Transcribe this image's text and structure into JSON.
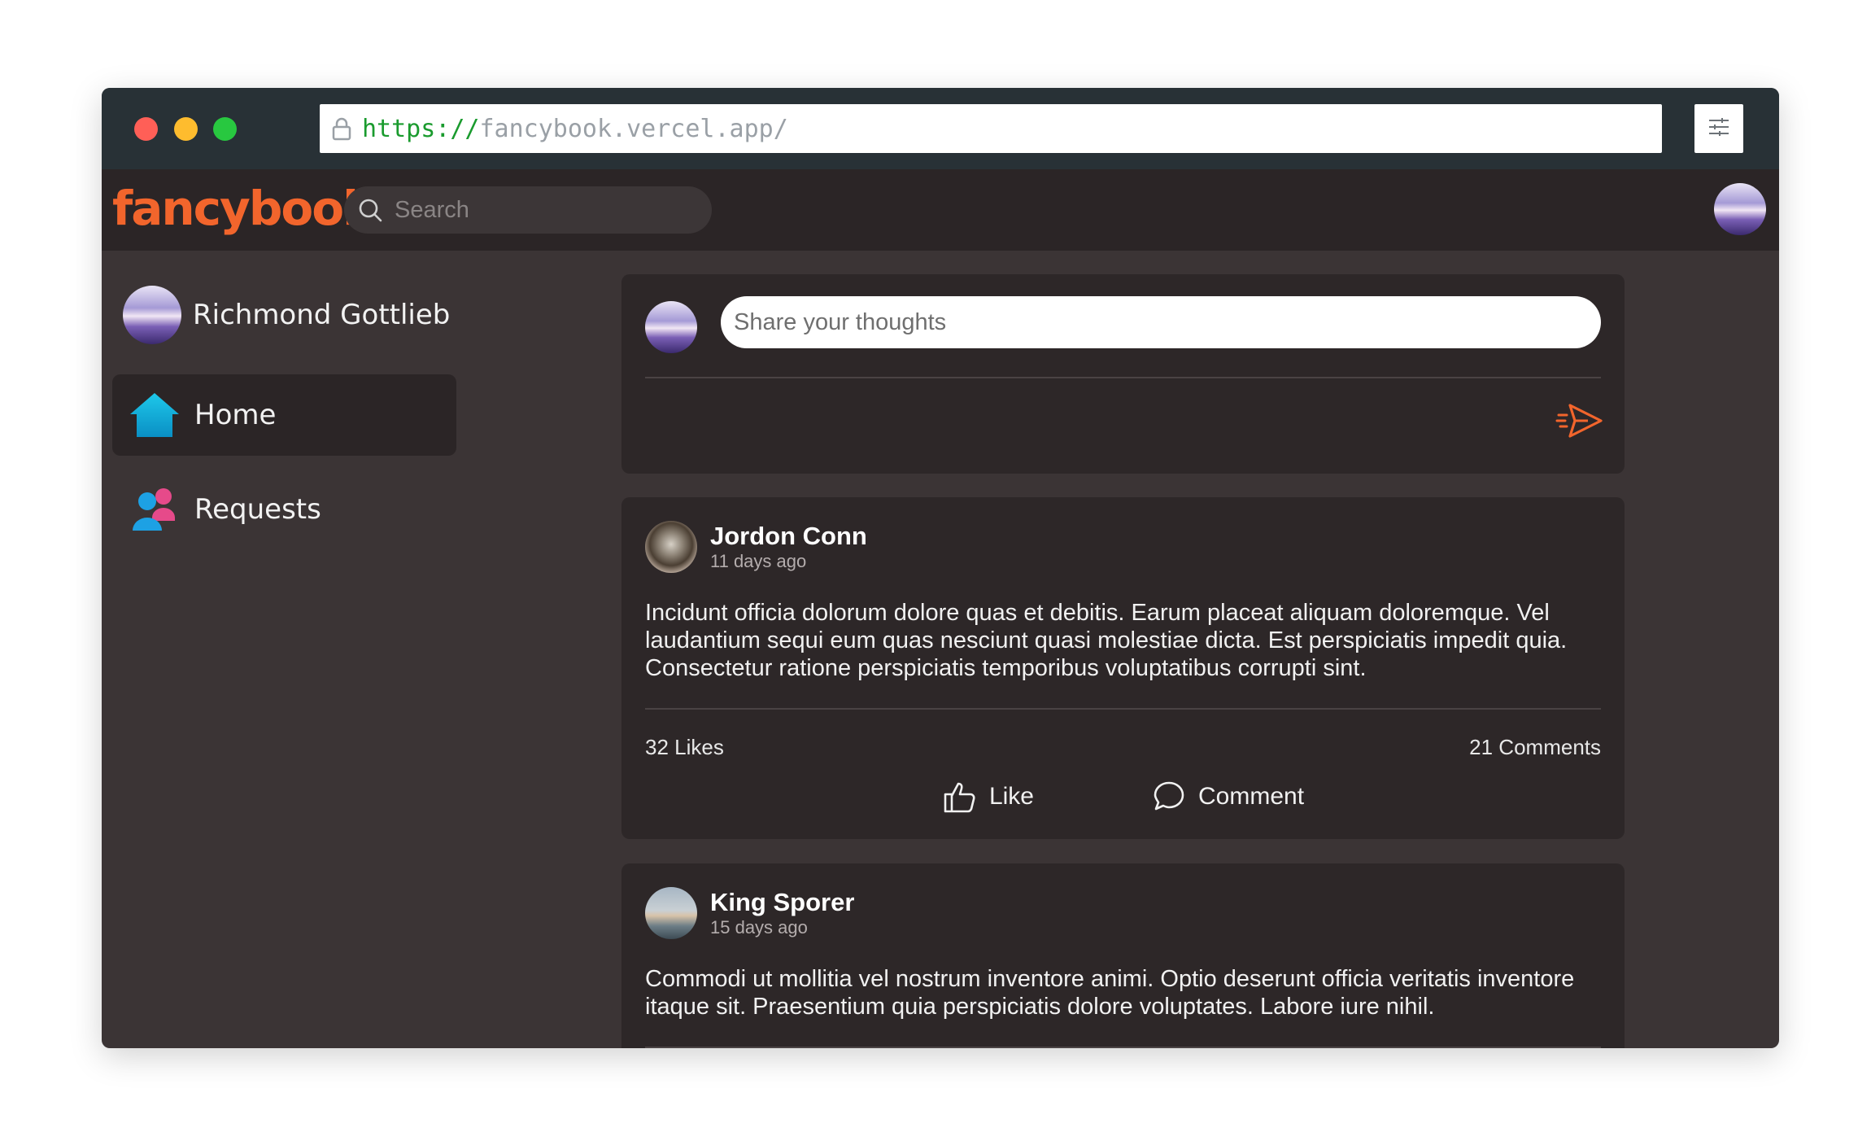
{
  "browser": {
    "url_scheme": "https://",
    "url_host": "fancybook.vercel.app/",
    "traffic_lights": [
      "#ff5f57",
      "#febc2e",
      "#28c840"
    ],
    "menu_icon": "sliders-icon"
  },
  "topnav": {
    "logo": "fancybook",
    "search_placeholder": "Search",
    "brand_color": "#f2652c"
  },
  "sidebar": {
    "user_name": "Richmond Gottlieb",
    "items": [
      {
        "label": "Home",
        "icon": "home-icon",
        "active": true
      },
      {
        "label": "Requests",
        "icon": "friends-icon",
        "active": false
      }
    ]
  },
  "composer": {
    "placeholder": "Share your thoughts",
    "send_icon": "send-icon"
  },
  "posts": [
    {
      "author": "Jordon Conn",
      "time": "11 days ago",
      "body": "Incidunt officia dolorum dolore quas et debitis. Earum placeat aliquam doloremque. Vel laudantium sequi eum quas nesciunt quasi molestiae dicta. Est perspiciatis impedit quia. Consectetur ratione perspiciatis temporibus voluptatibus corrupti sint.",
      "likes": "32 Likes",
      "comments": "21 Comments",
      "like_label": "Like",
      "comment_label": "Comment"
    },
    {
      "author": "King Sporer",
      "time": "15 days ago",
      "body": "Commodi ut mollitia vel nostrum inventore animi. Optio deserunt officia veritatis inventore itaque sit. Praesentium quia perspiciatis dolore voluptates. Labore iure nihil."
    }
  ]
}
